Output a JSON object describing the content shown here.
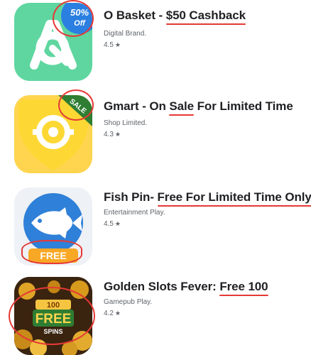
{
  "apps": [
    {
      "title_prefix": "O Basket - ",
      "title_highlight": "$50 Cashback",
      "title_suffix": "",
      "developer": "Digital Brand.",
      "rating": "4.5",
      "icon": "basket-a-logo-icon",
      "badge_line1": "50%",
      "badge_line2": "Off"
    },
    {
      "title_prefix": "Gmart - On ",
      "title_highlight": "Sale",
      "title_suffix": " For Limited Time",
      "developer": "Shop Limited.",
      "rating": "4.3",
      "icon": "guitar-pick-g-icon",
      "badge": "SALE"
    },
    {
      "title_prefix": "Fish Pin- ",
      "title_highlight": "Free For Limited Time Only",
      "title_suffix": "",
      "developer": "Entertainment Play.",
      "rating": "4.5",
      "icon": "fish-icon",
      "badge": "FREE"
    },
    {
      "title_prefix": "Golden Slots Fever: ",
      "title_highlight": "Free 100",
      "title_suffix": "",
      "developer": "Gamepub Play.",
      "rating": "4.2",
      "icon": "gold-coins-slots-icon",
      "badge_top": "100",
      "badge_main": "FREE",
      "badge_sub": "SPINS"
    }
  ],
  "star_glyph": "★",
  "colors": {
    "highlight": "#e53935",
    "app1_bg": "#5fd6a0",
    "app2_bg": "#ffd54f",
    "app3_bg": "#2f80d8",
    "app4_bg": "#3a2410"
  }
}
